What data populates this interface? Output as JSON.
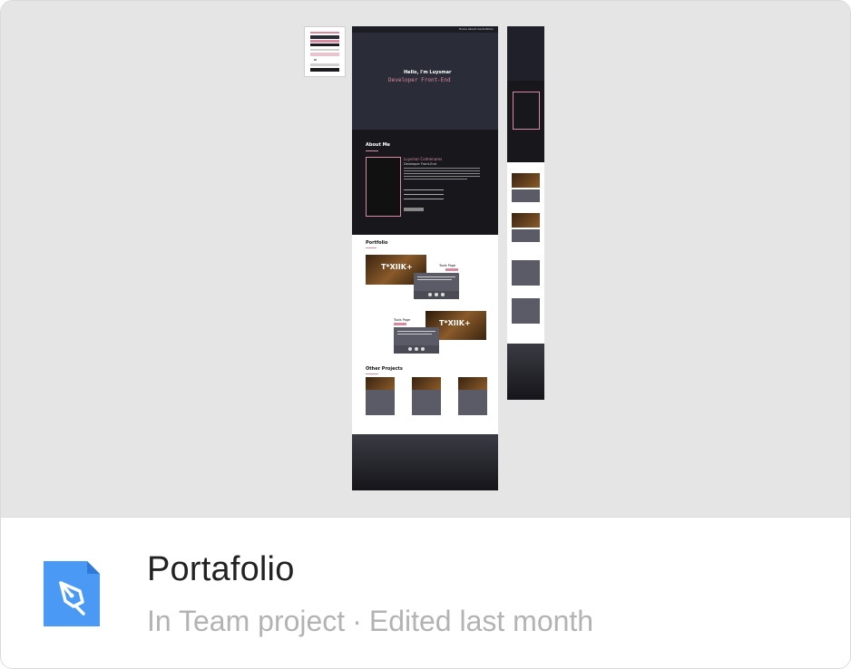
{
  "file": {
    "name": "Portafolio",
    "location": "In Team project",
    "separator": "·",
    "edited": "Edited last month",
    "icon": "pen-tool-file-icon",
    "icon_color": "#4a9af5"
  },
  "preview": {
    "background": "#e5e5e5",
    "hero": {
      "nav": [
        "Home",
        "About me",
        "Portfolio"
      ],
      "greeting": "Hello, I'm Luysmar",
      "role": "Developer Front-End"
    },
    "about": {
      "heading": "About Me",
      "name": "Luysmar Colmenares",
      "role": "Developer Front-End"
    },
    "portfolio": {
      "heading": "Portfolio",
      "logo": "T*XIIK+",
      "card_title": "Tools Page"
    },
    "other": {
      "heading": "Other Projects"
    }
  }
}
